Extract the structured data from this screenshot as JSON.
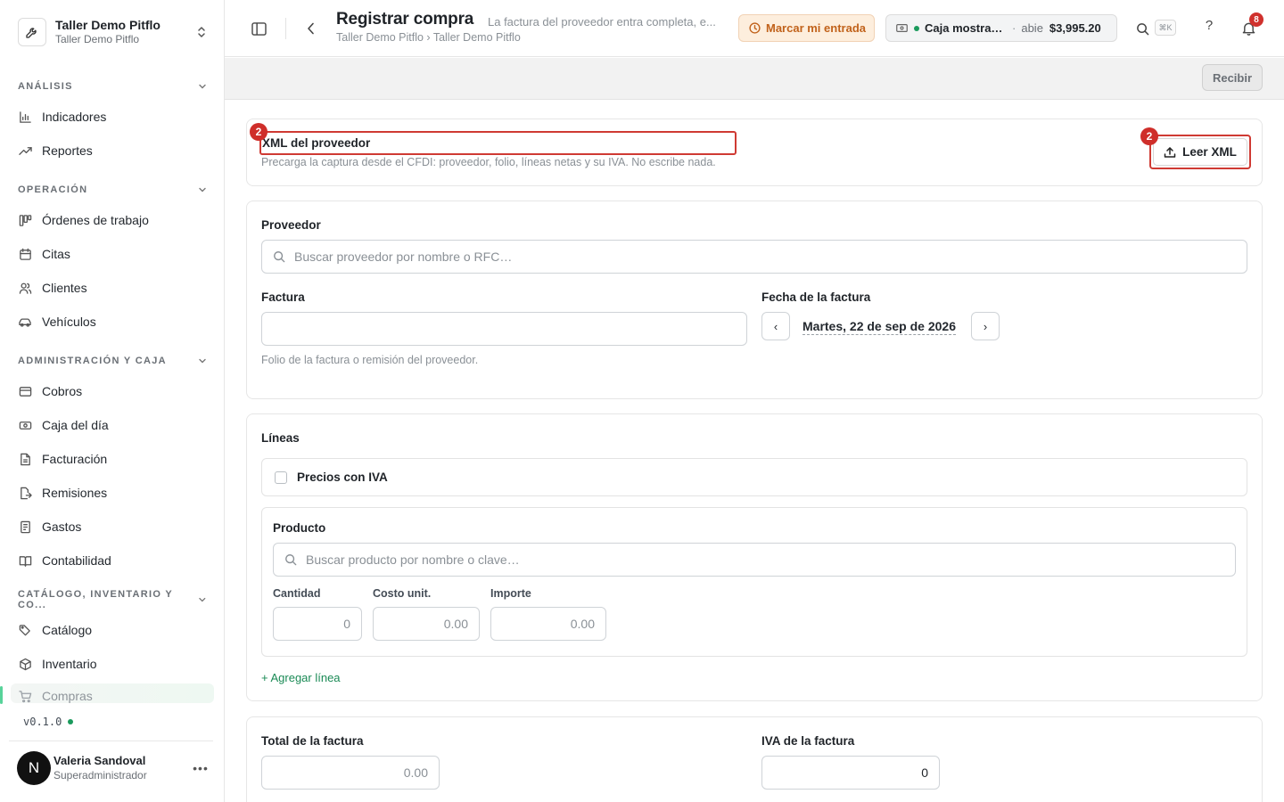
{
  "sidebar": {
    "org": {
      "name": "Taller Demo Pitflo",
      "sub": "Taller Demo Pitflo"
    },
    "sections": [
      {
        "label": "ANÁLISIS"
      },
      {
        "label": "OPERACIÓN"
      },
      {
        "label": "ADMINISTRACIÓN Y CAJA"
      },
      {
        "label": "CATÁLOGO, INVENTARIO Y CO..."
      }
    ],
    "items": [
      {
        "label": "Indicadores",
        "icon": "bar-chart-icon"
      },
      {
        "label": "Reportes",
        "icon": "trending-up-icon"
      },
      {
        "label": "Órdenes de trabajo",
        "icon": "kanban-icon"
      },
      {
        "label": "Citas",
        "icon": "calendar-icon"
      },
      {
        "label": "Clientes",
        "icon": "users-icon"
      },
      {
        "label": "Vehículos",
        "icon": "car-icon"
      },
      {
        "label": "Cobros",
        "icon": "credit-card-icon"
      },
      {
        "label": "Caja del día",
        "icon": "cash-icon"
      },
      {
        "label": "Facturación",
        "icon": "file-text-icon"
      },
      {
        "label": "Remisiones",
        "icon": "file-export-icon"
      },
      {
        "label": "Gastos",
        "icon": "receipt-icon"
      },
      {
        "label": "Contabilidad",
        "icon": "book-icon"
      },
      {
        "label": "Catálogo",
        "icon": "tags-icon"
      },
      {
        "label": "Inventario",
        "icon": "package-icon"
      },
      {
        "label": "Compras",
        "icon": "cart-icon",
        "active": true
      }
    ],
    "version": "v0.1.0",
    "user": {
      "initial": "N",
      "name": "Valeria Sandoval",
      "role": "Superadministrador",
      "more": "•••"
    }
  },
  "header": {
    "title": "Registrar compra",
    "description": "La factura del proveedor entra completa, e...",
    "breadcrumb": "Taller Demo Pitflo › Taller Demo Pitflo",
    "checkin_label": "Marcar mi entrada",
    "cash": {
      "name": "Caja mostrad...",
      "separator": "·",
      "state": "abie",
      "amount": "$3,995.20"
    },
    "search_shortcut": "⌘K",
    "help": "?",
    "notifications_count": "8"
  },
  "actionbar": {
    "receive_label": "Recibir"
  },
  "xml": {
    "title": "XML del proveedor",
    "help": "Precarga la captura desde el CFDI: proveedor, folio, líneas netas y su IVA. No escribe nada.",
    "button_label": "Leer XML",
    "marker_count": "2"
  },
  "supplier": {
    "label": "Proveedor",
    "placeholder": "Buscar proveedor por nombre o RFC…",
    "invoice_label": "Factura",
    "invoice_value": "",
    "invoice_help": "Folio de la factura o remisión del proveedor.",
    "date_label": "Fecha de la factura",
    "date_value": "Martes, 22 de sep de 2026",
    "prev": "‹",
    "next": "›"
  },
  "lines": {
    "label": "Líneas",
    "iva_prices_label": "Precios con IVA",
    "product_label": "Producto",
    "product_placeholder": "Buscar producto por nombre o clave…",
    "qty_label": "Cantidad",
    "qty_value": "0",
    "cost_label": "Costo unit.",
    "cost_value": "0.00",
    "amount_label": "Importe",
    "amount_value": "0.00",
    "add_line": "+ Agregar línea"
  },
  "totals": {
    "total_label": "Total de la factura",
    "total_value": "0.00",
    "iva_label": "IVA de la factura",
    "iva_value": "0"
  }
}
